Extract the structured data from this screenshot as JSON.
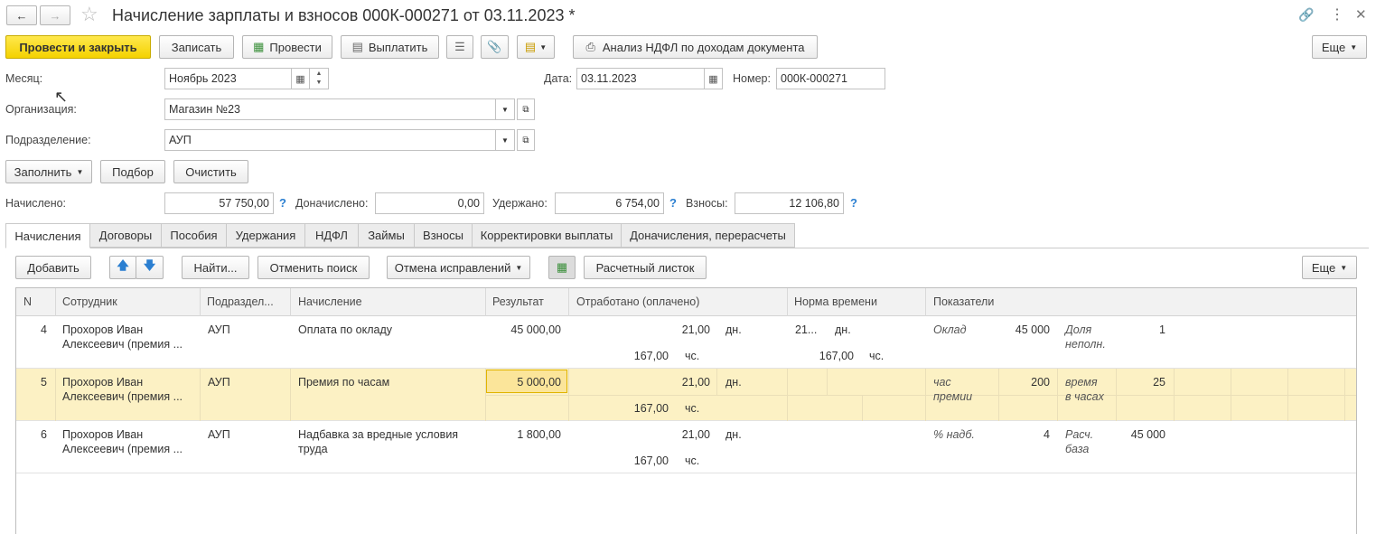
{
  "window": {
    "title": "Начисление зарплаты и взносов 000К-000271 от 03.11.2023 *"
  },
  "toolbar": {
    "post_close": "Провести и закрыть",
    "save": "Записать",
    "post": "Провести",
    "pay": "Выплатить",
    "ndfl_analysis": "Анализ НДФЛ по доходам документа",
    "more": "Еще"
  },
  "form": {
    "month_label": "Месяц:",
    "month_value": "Ноябрь 2023",
    "date_label": "Дата:",
    "date_value": "03.11.2023",
    "number_label": "Номер:",
    "number_value": "000К-000271",
    "org_label": "Организация:",
    "org_value": "Магазин №23",
    "dept_label": "Подразделение:",
    "dept_value": "АУП",
    "fill": "Заполнить",
    "pick": "Подбор",
    "clear": "Очистить"
  },
  "totals": {
    "accrued_label": "Начислено:",
    "accrued_value": "57 750,00",
    "extra_label": "Доначислено:",
    "extra_value": "0,00",
    "withheld_label": "Удержано:",
    "withheld_value": "6 754,00",
    "contrib_label": "Взносы:",
    "contrib_value": "12 106,80",
    "help": "?"
  },
  "tabs": [
    "Начисления",
    "Договоры",
    "Пособия",
    "Удержания",
    "НДФЛ",
    "Займы",
    "Взносы",
    "Корректировки выплаты",
    "Доначисления, перерасчеты"
  ],
  "grid_toolbar": {
    "add": "Добавить",
    "find": "Найти...",
    "cancel_search": "Отменить поиск",
    "cancel_fix": "Отмена исправлений",
    "payslip": "Расчетный листок",
    "more": "Еще"
  },
  "columns": [
    "N",
    "Сотрудник",
    "Подраздел...",
    "Начисление",
    "Результат",
    "Отработано (оплачено)",
    "Норма времени",
    "Показатели"
  ],
  "rows": [
    {
      "n": "4",
      "emp1": "Прохоров Иван",
      "emp2": "Алексеевич (премия ...",
      "dept": "АУП",
      "acc1": "Оплата по окладу",
      "acc2": "",
      "result": "45 000,00",
      "days": "21,00",
      "days_u": "дн.",
      "hours": "167,00",
      "hours_u": "чс.",
      "norm_days": "21...",
      "norm_days_u": "дн.",
      "norm_hours": "167,00",
      "norm_hours_u": "чс.",
      "ind1a": "Оклад",
      "ind1b": "",
      "ind1v": "45 000",
      "ind2a": "Доля",
      "ind2b": "неполн.",
      "ind2v": "1"
    },
    {
      "n": "5",
      "emp1": "Прохоров Иван",
      "emp2": "Алексеевич (премия ...",
      "dept": "АУП",
      "acc1": "Премия по часам",
      "acc2": "",
      "result": "5 000,00",
      "days": "21,00",
      "days_u": "дн.",
      "hours": "167,00",
      "hours_u": "чс.",
      "norm_days": "",
      "norm_days_u": "",
      "norm_hours": "",
      "norm_hours_u": "",
      "ind1a": "час",
      "ind1b": "премии",
      "ind1v": "200",
      "ind2a": "время",
      "ind2b": "в часах",
      "ind2v": "25"
    },
    {
      "n": "6",
      "emp1": "Прохоров Иван",
      "emp2": "Алексеевич (премия ...",
      "dept": "АУП",
      "acc1": "Надбавка за вредные условия",
      "acc2": "труда",
      "result": "1 800,00",
      "days": "21,00",
      "days_u": "дн.",
      "hours": "167,00",
      "hours_u": "чс.",
      "norm_days": "",
      "norm_days_u": "",
      "norm_hours": "",
      "norm_hours_u": "",
      "ind1a": "% надб.",
      "ind1b": "",
      "ind1v": "4",
      "ind2a": "Расч.",
      "ind2b": "база",
      "ind2v": "45 000"
    }
  ],
  "colors": {
    "accent_yellow": "#f4d200",
    "selected_row": "#fcf1c4",
    "help_blue": "#2b7fd1"
  }
}
